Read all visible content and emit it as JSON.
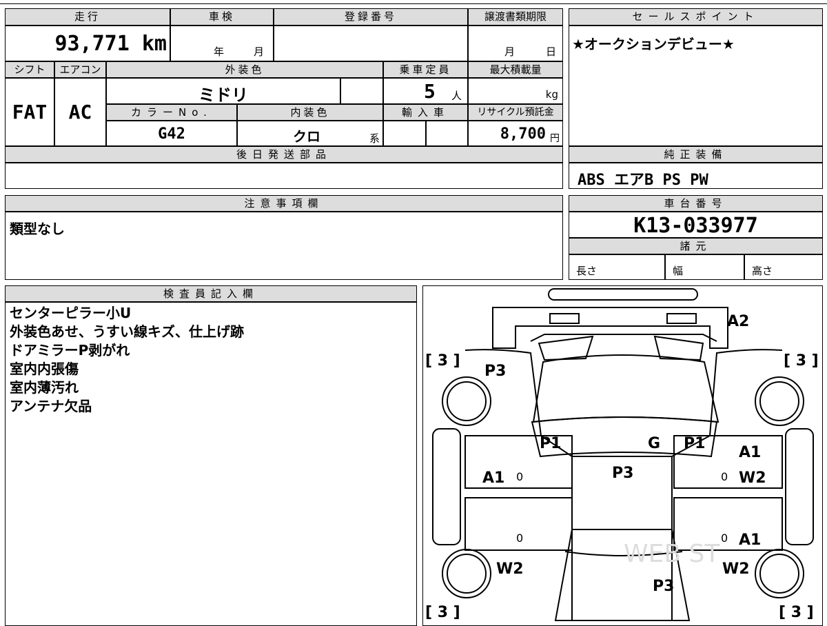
{
  "top": {
    "mileage_label": "走行",
    "mileage_value": "93,771 km",
    "inspection_label": "車検",
    "inspection_year_unit": "年",
    "inspection_month_unit": "月",
    "registration_label": "登録番号",
    "transfer_deadline_label": "譲渡書類期限",
    "transfer_month_unit": "月",
    "transfer_day_unit": "日"
  },
  "specs": {
    "shift_label": "シフト",
    "shift_value": "FAT",
    "ac_label": "エアコン",
    "ac_value": "AC",
    "exterior_color_label": "外装色",
    "exterior_color_value": "ミドリ",
    "capacity_label": "乗車定員",
    "capacity_value": "5",
    "capacity_unit": "人",
    "max_load_label": "最大積載量",
    "max_load_unit": "kg",
    "color_no_label": "カラーNo.",
    "color_no_value": "G42",
    "interior_color_label": "内装色",
    "interior_color_value": "クロ",
    "interior_color_suffix": "系",
    "import_label": "輸入車",
    "recycle_label": "リサイクル預託金",
    "recycle_value": "8,700",
    "recycle_unit": "円"
  },
  "sales_point": {
    "label": "セールスポイント",
    "text": "★オークションデビュー★"
  },
  "later_parts": {
    "label": "後日発送部品"
  },
  "equipment": {
    "label": "純正装備",
    "text": "ABS エアB PS PW"
  },
  "notes": {
    "label": "注意事項欄",
    "text": "類型なし"
  },
  "chassis": {
    "label": "車台番号",
    "value": "K13-033977"
  },
  "dimensions": {
    "label": "諸元",
    "length_label": "長さ",
    "width_label": "幅",
    "height_label": "高さ"
  },
  "inspector": {
    "label": "検査員記入欄",
    "lines": [
      "センターピラー小U",
      "外装色あせ、うすい線キズ、仕上げ跡",
      "ドアミラーP剥がれ",
      "室内内張傷",
      "室内薄汚れ",
      "アンテナ欠品"
    ]
  },
  "diagram": {
    "tire_fl": "[ 3 ]",
    "tire_fr": "[ 3 ]",
    "tire_rl": "[ 3 ]",
    "tire_rr": "[ 3 ]",
    "front_bumper": "A2",
    "hood_left": "P3",
    "pillar_left": "P1",
    "pillar_right": "P1",
    "glass": "G",
    "roof": "P3",
    "front_door_left": "A1",
    "front_door_right_1": "A1",
    "front_door_right_2": "W2",
    "rear_door_right": "A1",
    "rear_fender_left": "W2",
    "rear_fender_right": "W2",
    "trunk": "P3",
    "zero_1": "0",
    "zero_2": "0",
    "zero_3": "0",
    "zero_4": "0"
  }
}
